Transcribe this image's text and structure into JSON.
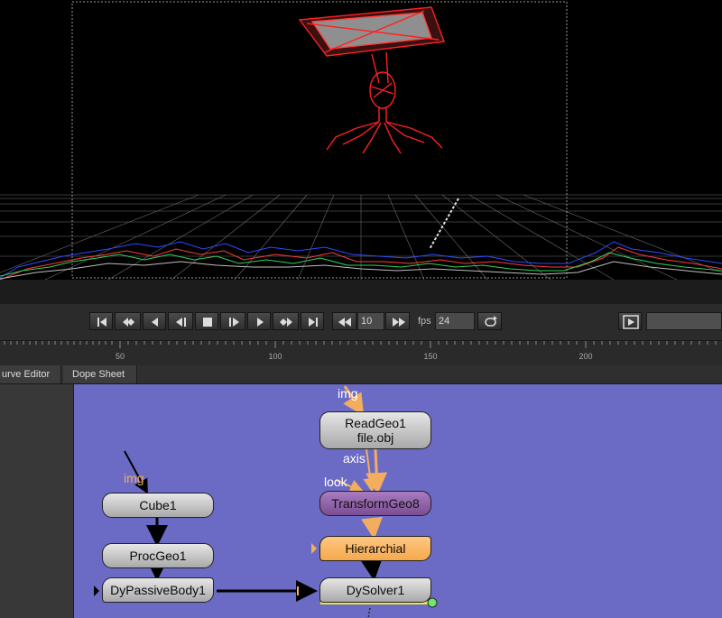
{
  "transport": {
    "frame_value": "10",
    "fps_label": "fps",
    "fps_value": "24"
  },
  "ruler": {
    "ticks": [
      {
        "value": "50"
      },
      {
        "value": "100"
      },
      {
        "value": "150"
      },
      {
        "value": "200"
      }
    ]
  },
  "tabs": [
    {
      "label": "urve Editor"
    },
    {
      "label": "Dope Sheet"
    }
  ],
  "graph": {
    "nodes": {
      "readgeo": {
        "title": "ReadGeo1",
        "subtitle": "file.obj"
      },
      "transformgeo": {
        "title": "TransformGeo8"
      },
      "hierarchial": {
        "title": "Hierarchial"
      },
      "dysolver": {
        "title": "DySolver1"
      },
      "cube": {
        "title": "Cube1"
      },
      "procgeo": {
        "title": "ProcGeo1"
      },
      "dypassive": {
        "title": "DyPassiveBody1"
      }
    },
    "port_labels": {
      "img_top": "img",
      "axis": "axis",
      "look": "look",
      "img_left": "img"
    },
    "colors": {
      "background": "#6b6bc6",
      "gray_node": "#c8c8c8",
      "purple_node": "#8e62a6",
      "orange_node": "#f8b565",
      "edge_orange": "#f2ad5f",
      "edge_black": "#000000"
    }
  }
}
